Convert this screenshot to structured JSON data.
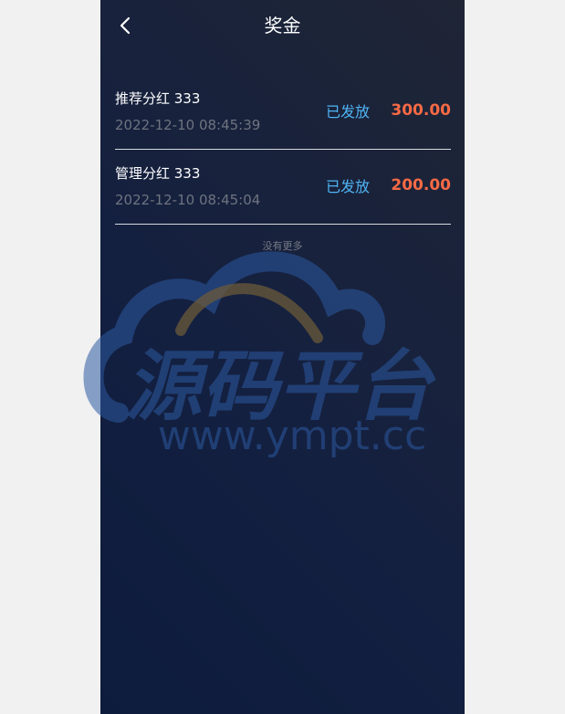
{
  "header": {
    "back_icon": "chevron-left-icon",
    "title": "奖金"
  },
  "bonus_list": [
    {
      "name": "推荐分红 333",
      "time": "2022-12-10 08:45:39",
      "status": "已发放",
      "amount": "300.00"
    },
    {
      "name": "管理分红 333",
      "time": "2022-12-10 08:45:04",
      "status": "已发放",
      "amount": "200.00"
    }
  ],
  "footer": {
    "no_more": "没有更多"
  },
  "watermark": {
    "title": "源码平台",
    "url": "www.ympt.cc"
  },
  "colors": {
    "background": "#142040",
    "status": "#4fb4f5",
    "amount": "#f66a45",
    "divider": "#d7d9de"
  }
}
